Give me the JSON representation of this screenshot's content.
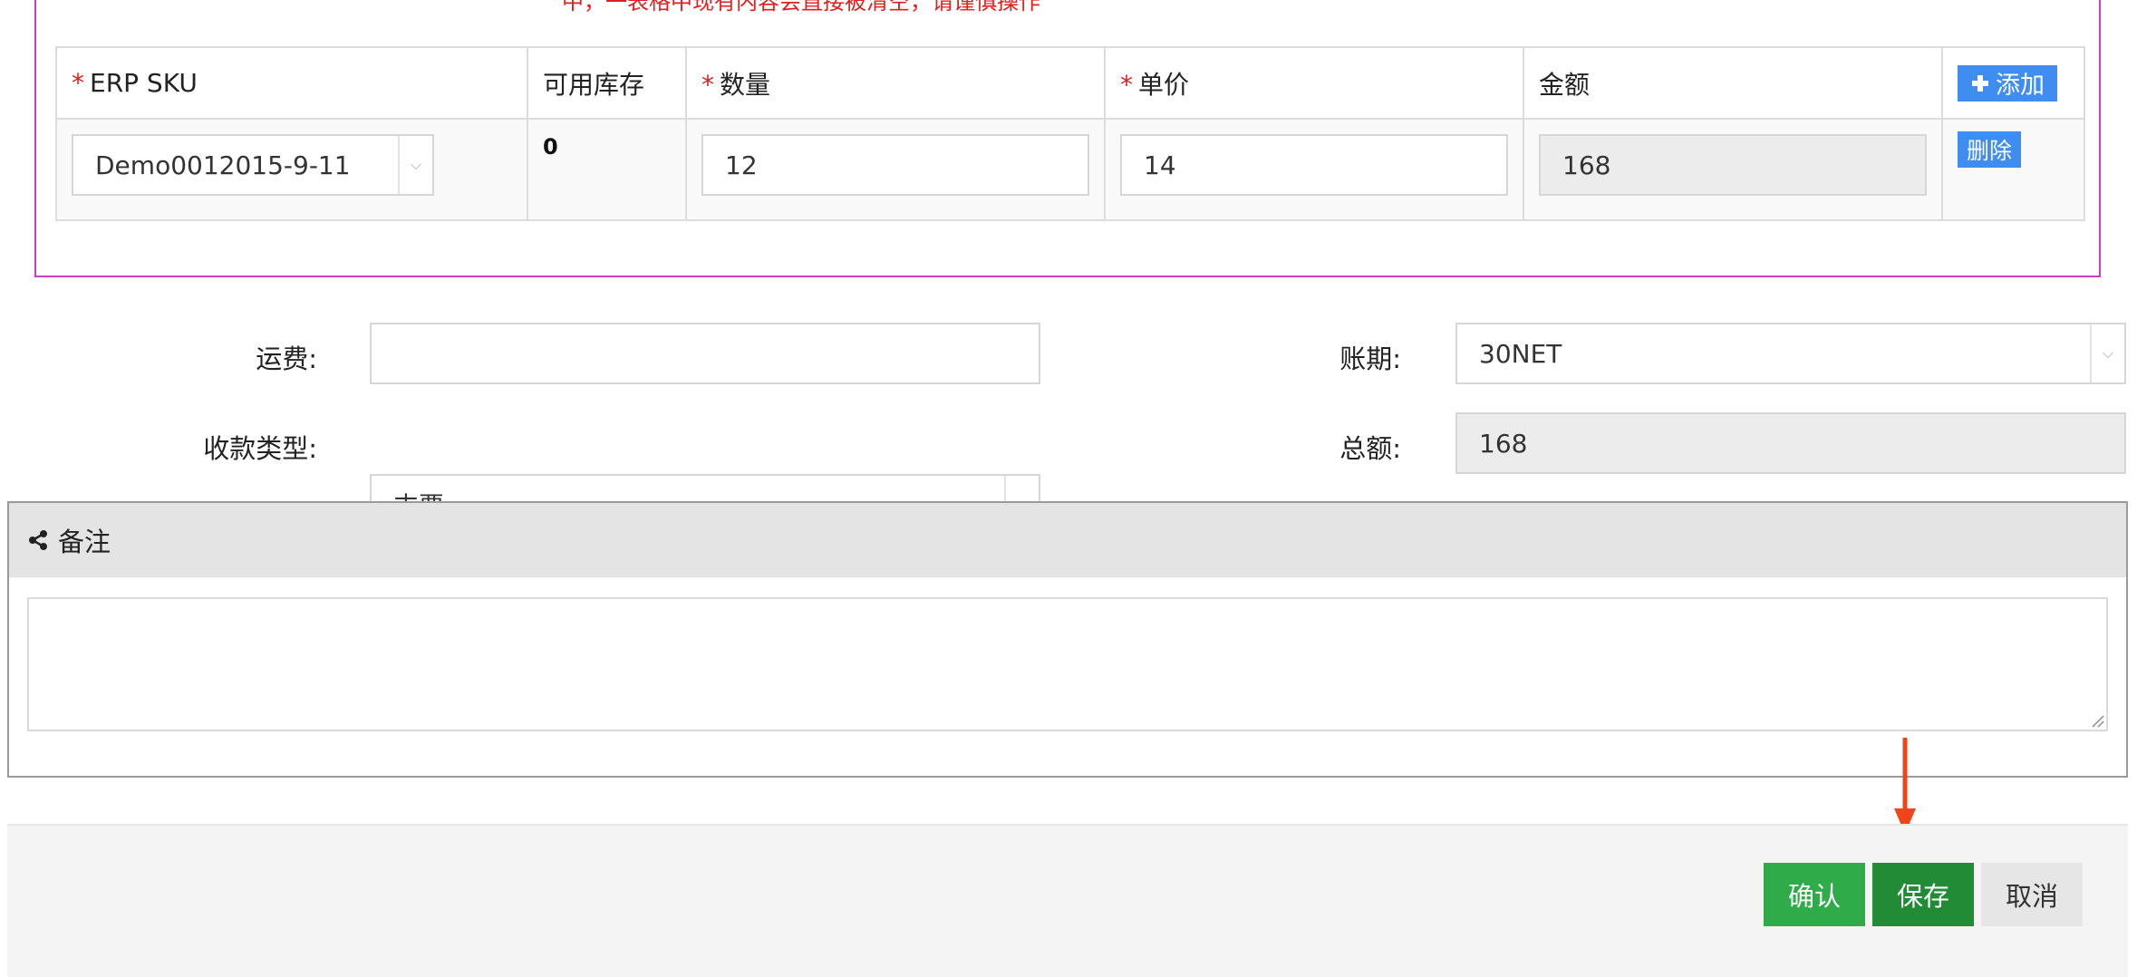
{
  "warning_text": "中，一表格中现有内容会直接被清空，请谨慎操作",
  "sku_table": {
    "headers": {
      "erp_sku": "ERP SKU",
      "available_stock": "可用库存",
      "quantity": "数量",
      "unit_price": "单价",
      "amount": "金额"
    },
    "required_mark": "*",
    "add_button": "添加",
    "rows": [
      {
        "erp_sku": "Demo0012015-9-11",
        "available_stock": "0",
        "quantity": "12",
        "unit_price": "14",
        "amount": "168",
        "delete_button": "删除"
      }
    ]
  },
  "form": {
    "shipping_label": "运费:",
    "shipping_value": "",
    "payment_term_label": "账期:",
    "payment_term_value": "30NET",
    "payment_type_label": "收款类型:",
    "payment_type_value": "支票",
    "total_label": "总额:",
    "total_value": "168"
  },
  "remark": {
    "title": "备注",
    "value": ""
  },
  "buttons": {
    "confirm": "确认",
    "save": "保存",
    "cancel": "取消"
  },
  "colors": {
    "accent_blue": "#3f8df0",
    "confirm_green": "#2fab4a",
    "save_green": "#228b36",
    "required_red": "#e02020",
    "annotation_arrow": "#f0441a",
    "section_border": "#c640c6"
  },
  "icons": {
    "add": "plus-icon",
    "remark": "share-icon",
    "dropdown": "chevron-down-icon",
    "annotation": "arrow-down-icon"
  }
}
